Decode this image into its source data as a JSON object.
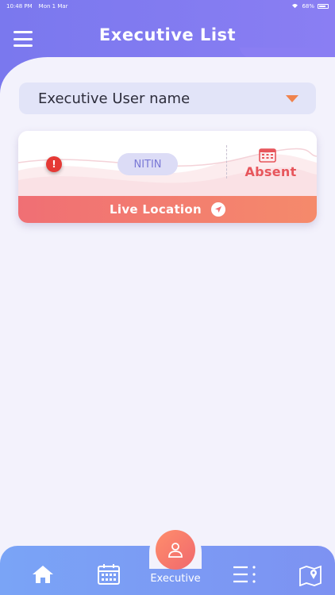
{
  "status_bar": {
    "time": "10:48 PM",
    "date": "Mon 1 Mar",
    "battery": "68%"
  },
  "header": {
    "title": "Executive List"
  },
  "dropdown": {
    "label": "Executive User name"
  },
  "card": {
    "name": "NITIN",
    "status": "Absent",
    "footer_label": "Live Location"
  },
  "bottom_nav": {
    "active_label": "Executive"
  },
  "colors": {
    "header": "#7a78ee",
    "accent_orange": "#f0834d",
    "absent_red": "#e7565c",
    "nav_blue": "#7aa4f6"
  }
}
